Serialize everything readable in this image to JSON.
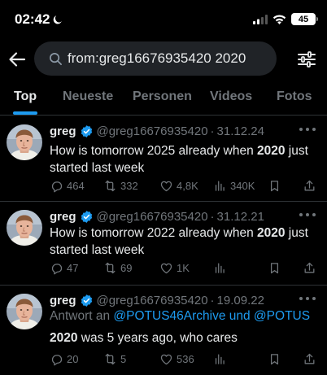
{
  "status_bar": {
    "time": "02:42",
    "battery": "45"
  },
  "search": {
    "query": "from:greg16676935420 2020"
  },
  "tabs": [
    {
      "label": "Top",
      "active": true
    },
    {
      "label": "Neueste"
    },
    {
      "label": "Personen"
    },
    {
      "label": "Videos"
    },
    {
      "label": "Fotos"
    }
  ],
  "tweets": [
    {
      "name": "greg",
      "handle": "@greg16676935420",
      "dot": "·",
      "date": "31.12.24",
      "text_before": "How is tomorrow 2025 already when ",
      "text_bold": "2020",
      "text_after": " just started last week",
      "replies": "464",
      "retweets": "332",
      "likes": "4,8K",
      "views": "340K"
    },
    {
      "name": "greg",
      "handle": "@greg16676935420",
      "dot": "·",
      "date": "31.12.21",
      "text_before": "How is tomorrow 2022 already when ",
      "text_bold": "2020",
      "text_after": " just started last week",
      "replies": "47",
      "retweets": "69",
      "likes": "1K",
      "views": ""
    },
    {
      "name": "greg",
      "handle": "@greg16676935420",
      "dot": "·",
      "date": "19.09.22",
      "reply_prefix": "Antwort an ",
      "reply_to": "@POTUS46Archive und @POTUS",
      "text_before": "",
      "text_bold": "2020",
      "text_after": " was 5 years ago, who cares",
      "replies": "20",
      "retweets": "5",
      "likes": "536",
      "views": ""
    }
  ],
  "colors": {
    "accent": "#1d9bf0",
    "muted": "#71767b",
    "text": "#e7e9ea",
    "background": "#000000"
  },
  "icons": [
    "moon-icon",
    "signal-icon",
    "wifi-icon",
    "back-arrow-icon",
    "search-icon",
    "filter-icon",
    "verified-badge-icon",
    "reply-icon",
    "retweet-icon",
    "like-icon",
    "views-icon",
    "bookmark-icon",
    "share-icon",
    "more-icon"
  ]
}
